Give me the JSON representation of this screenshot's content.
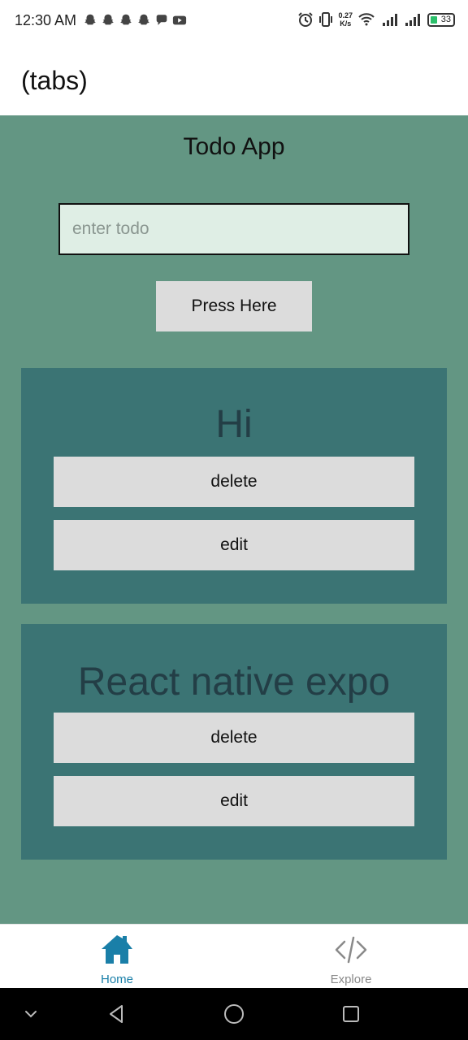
{
  "status_bar": {
    "time": "12:30 AM",
    "notifications": [
      "snapchat-icon",
      "snapchat-icon",
      "snapchat-icon",
      "snapchat-icon",
      "chat-bubble-icon",
      "youtube-icon"
    ],
    "net_speed_value": "0.27",
    "net_speed_unit": "K/s",
    "battery_level": "33"
  },
  "header": {
    "title": "(tabs)"
  },
  "main": {
    "title": "Todo App",
    "input": {
      "placeholder": "enter todo",
      "value": ""
    },
    "submit_label": "Press Here",
    "todos": [
      {
        "text": "Hi",
        "delete_label": "delete",
        "edit_label": "edit"
      },
      {
        "text": "React native expo",
        "delete_label": "delete",
        "edit_label": "edit"
      }
    ]
  },
  "tabs": [
    {
      "label": "Home",
      "icon": "home-icon",
      "active": true
    },
    {
      "label": "Explore",
      "icon": "code-icon",
      "active": false
    }
  ],
  "colors": {
    "content_bg": "#639683",
    "card_bg": "#3b7474",
    "card_text": "#233e46",
    "input_bg": "#dfeee5",
    "button_bg": "#dcdcdc",
    "active_tab": "#1a7fa8",
    "inactive_tab": "#8a8a8a"
  }
}
